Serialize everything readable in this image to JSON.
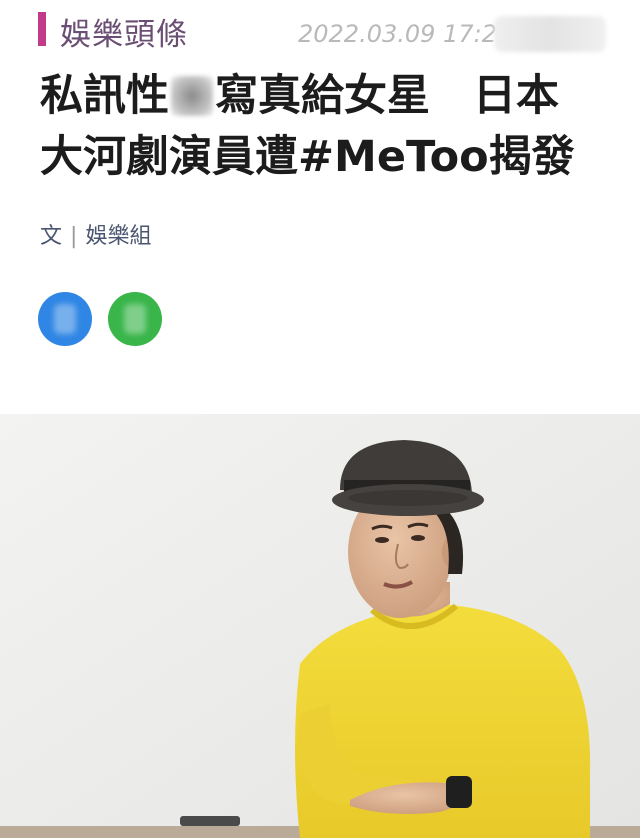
{
  "header": {
    "category": "娛樂頭條",
    "timestamp": "2022.03.09 17:26",
    "accent_color": "#c23a8a"
  },
  "article": {
    "headline_line1_a": "私訊性",
    "headline_line1_b": "寫真給女星　日本",
    "headline_line2": "大河劇演員遭#MeToo揭發",
    "byline_prefix": "文",
    "byline_sep": "|",
    "byline_author": "娛樂組"
  },
  "social": {
    "share_button_1_color": "#2f86e4",
    "share_button_2_color": "#39b54a"
  },
  "photo": {
    "subject": "man in gray hat and yellow sweater gesturing"
  }
}
